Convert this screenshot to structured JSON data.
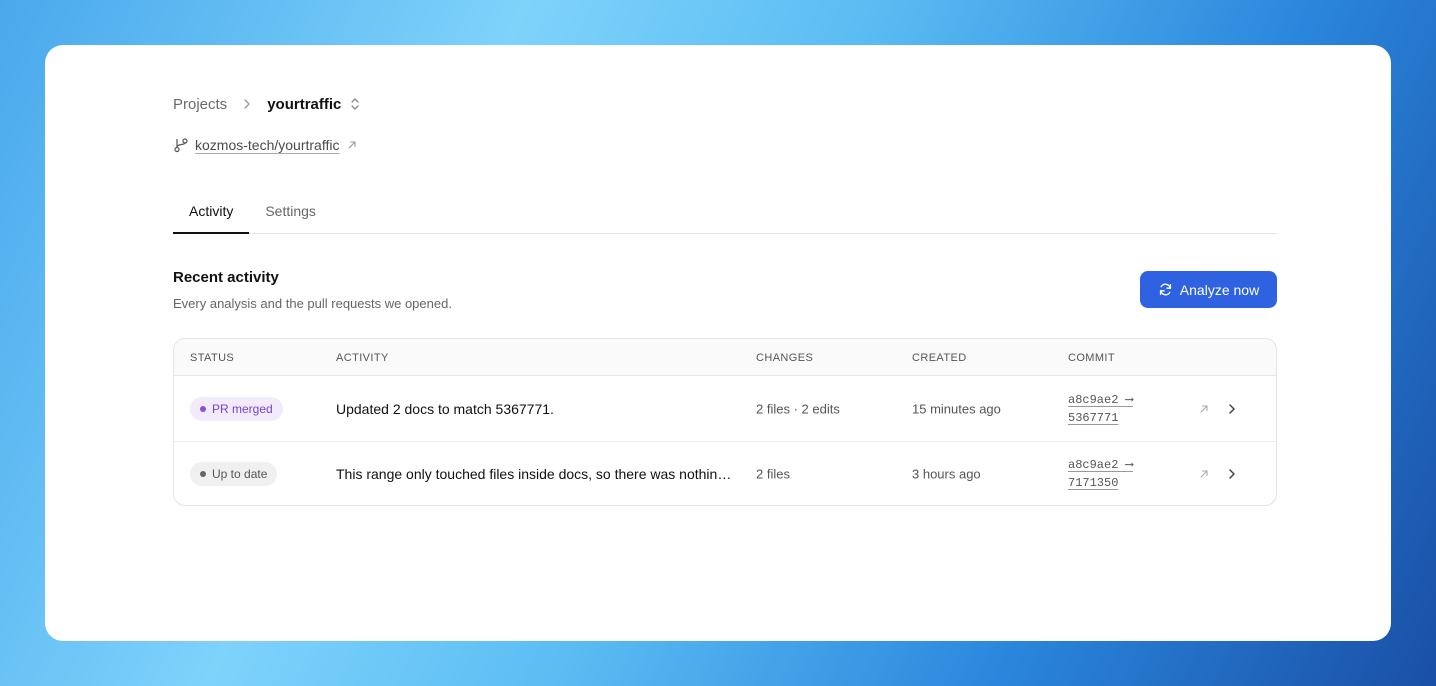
{
  "breadcrumb": {
    "projects": "Projects",
    "current": "yourtraffic"
  },
  "repo": {
    "name": "kozmos-tech/yourtraffic"
  },
  "tabs": [
    {
      "label": "Activity",
      "active": true
    },
    {
      "label": "Settings",
      "active": false
    }
  ],
  "section": {
    "title": "Recent activity",
    "subtitle": "Every analysis and the pull requests we opened."
  },
  "analyze_button": {
    "label": "Analyze now",
    "color": "#2e62e0"
  },
  "table": {
    "headers": [
      "STATUS",
      "ACTIVITY",
      "CHANGES",
      "CREATED",
      "COMMIT"
    ],
    "rows": [
      {
        "status": "PR merged",
        "status_color": "#7a3fd0",
        "activity": "Updated 2 docs to match 5367771.",
        "changes": "2 files · 2 edits",
        "created": "15 minutes ago",
        "commit_from": "a8c9ae2 ⟶",
        "commit_to": "5367771"
      },
      {
        "status": "Up to date",
        "status_color": "#555555",
        "activity": "This range only touched files inside docs, so there was nothing to update.",
        "changes": "2 files",
        "created": "3 hours ago",
        "commit_from": "a8c9ae2 ⟶",
        "commit_to": "7171350"
      }
    ]
  }
}
